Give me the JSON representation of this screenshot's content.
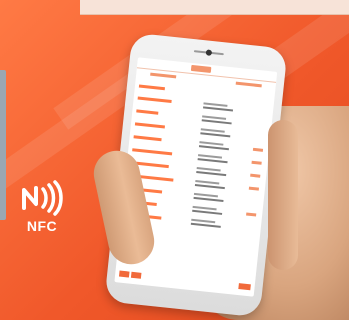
{
  "nfc": {
    "label": "NFC",
    "icon": "nfc-wave-icon"
  },
  "colors": {
    "background": "#f0582a",
    "accent": "#ff7a45",
    "banner": "#f7e3d8",
    "skin": "#d9a57f",
    "phone": "#eeeeee"
  },
  "phone_screen": {
    "header": "",
    "tabs": [
      "",
      ""
    ],
    "rows": [
      {
        "left": "",
        "right": ""
      },
      {
        "left": "",
        "right": ""
      },
      {
        "left": "",
        "right": ""
      },
      {
        "left": "",
        "right": ""
      },
      {
        "left": "",
        "right": ""
      },
      {
        "left": "",
        "right": ""
      },
      {
        "left": "",
        "right": ""
      },
      {
        "left": "",
        "right": ""
      },
      {
        "left": "",
        "right": ""
      },
      {
        "left": "",
        "right": ""
      },
      {
        "left": "",
        "right": ""
      }
    ]
  }
}
